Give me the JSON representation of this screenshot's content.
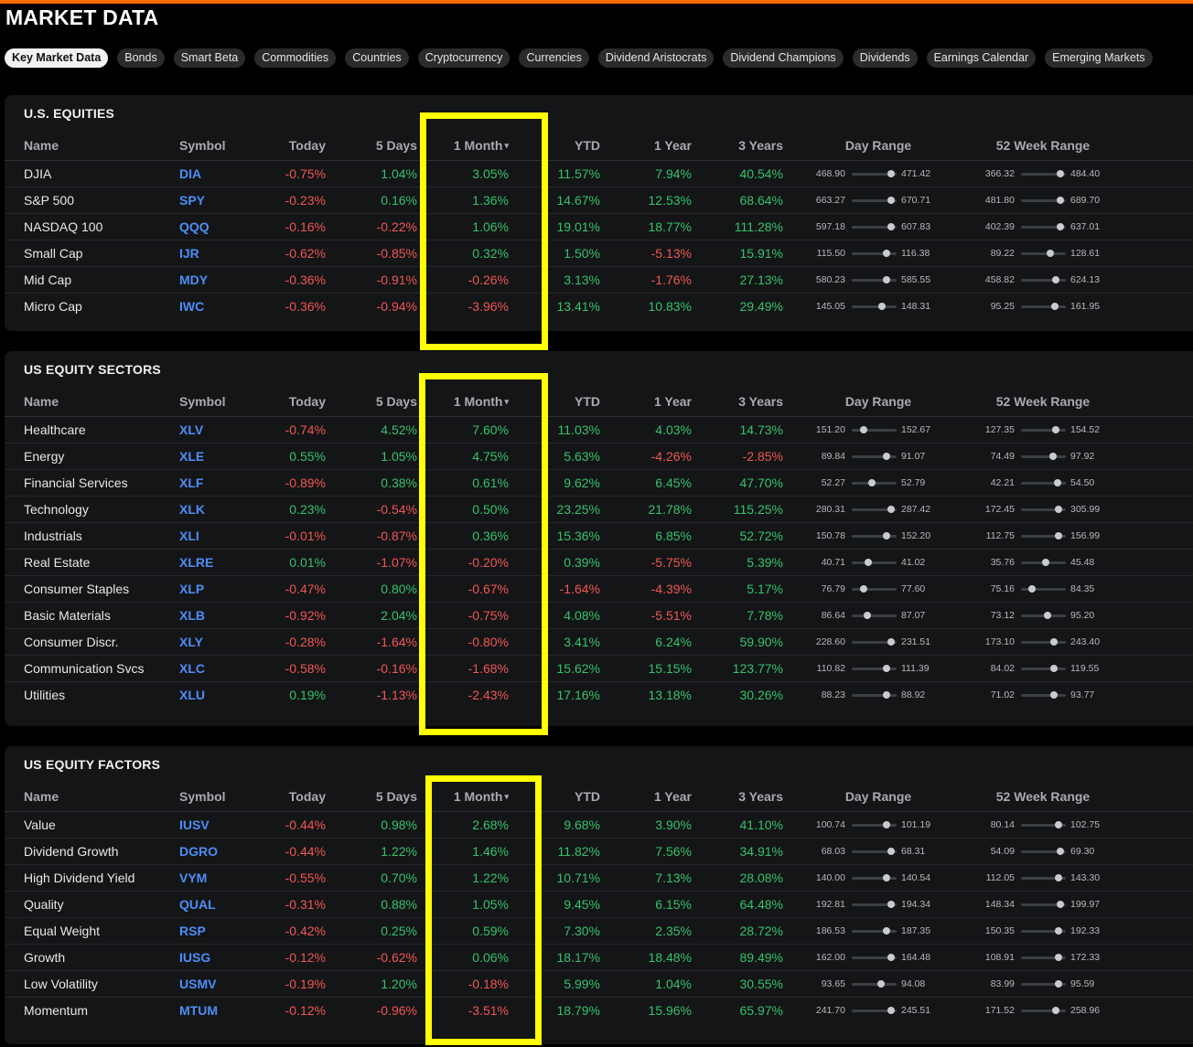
{
  "page": {
    "title": "MARKET DATA",
    "accent_color": "#ff6a00",
    "highlight_color": "#ffff00"
  },
  "tabs": [
    "Key Market Data",
    "Bonds",
    "Smart Beta",
    "Commodities",
    "Countries",
    "Cryptocurrency",
    "Currencies",
    "Dividend Aristocrats",
    "Dividend Champions",
    "Dividends",
    "Earnings Calendar",
    "Emerging Markets"
  ],
  "active_tab": "Key Market Data",
  "columns": {
    "name": "Name",
    "symbol": "Symbol",
    "today": "Today",
    "five_days": "5 Days",
    "one_month": "1 Month",
    "sort_indicator": "▾",
    "ytd": "YTD",
    "one_year": "1 Year",
    "three_years": "3 Years",
    "day_range": "Day Range",
    "week52_range": "52 Week Range"
  },
  "sections": [
    {
      "title": "U.S. EQUITIES",
      "rows": [
        {
          "name": "DJIA",
          "symbol": "DIA",
          "today": "-0.75%",
          "five_days": "1.04%",
          "one_month": "3.05%",
          "ytd": "11.57%",
          "one_year": "7.94%",
          "three_years": "40.54%",
          "day_low": "468.90",
          "day_high": "471.42",
          "day_pos": 0.88,
          "wk_low": "366.32",
          "wk_high": "484.40",
          "wk_pos": 0.88
        },
        {
          "name": "S&P 500",
          "symbol": "SPY",
          "today": "-0.23%",
          "five_days": "0.16%",
          "one_month": "1.36%",
          "ytd": "14.67%",
          "one_year": "12.53%",
          "three_years": "68.64%",
          "day_low": "663.27",
          "day_high": "670.71",
          "day_pos": 0.88,
          "wk_low": "481.80",
          "wk_high": "689.70",
          "wk_pos": 0.88
        },
        {
          "name": "NASDAQ 100",
          "symbol": "QQQ",
          "today": "-0.16%",
          "five_days": "-0.22%",
          "one_month": "1.06%",
          "ytd": "19.01%",
          "one_year": "18.77%",
          "three_years": "111.28%",
          "day_low": "597.18",
          "day_high": "607.83",
          "day_pos": 0.88,
          "wk_low": "402.39",
          "wk_high": "637.01",
          "wk_pos": 0.88
        },
        {
          "name": "Small Cap",
          "symbol": "IJR",
          "today": "-0.62%",
          "five_days": "-0.85%",
          "one_month": "0.32%",
          "ytd": "1.50%",
          "one_year": "-5.13%",
          "three_years": "15.91%",
          "day_low": "115.50",
          "day_high": "116.38",
          "day_pos": 0.77,
          "wk_low": "89.22",
          "wk_high": "128.61",
          "wk_pos": 0.66
        },
        {
          "name": "Mid Cap",
          "symbol": "MDY",
          "today": "-0.36%",
          "five_days": "-0.91%",
          "one_month": "-0.26%",
          "ytd": "3.13%",
          "one_year": "-1.76%",
          "three_years": "27.13%",
          "day_low": "580.23",
          "day_high": "585.55",
          "day_pos": 0.78,
          "wk_low": "458.82",
          "wk_high": "624.13",
          "wk_pos": 0.77
        },
        {
          "name": "Micro Cap",
          "symbol": "IWC",
          "today": "-0.36%",
          "five_days": "-0.94%",
          "one_month": "-3.96%",
          "ytd": "13.41%",
          "one_year": "10.83%",
          "three_years": "29.49%",
          "day_low": "145.05",
          "day_high": "148.31",
          "day_pos": 0.67,
          "wk_low": "95.25",
          "wk_high": "161.95",
          "wk_pos": 0.76
        }
      ]
    },
    {
      "title": "US EQUITY SECTORS",
      "rows": [
        {
          "name": "Healthcare",
          "symbol": "XLV",
          "today": "-0.74%",
          "five_days": "4.52%",
          "one_month": "7.60%",
          "ytd": "11.03%",
          "one_year": "4.03%",
          "three_years": "14.73%",
          "day_low": "151.20",
          "day_high": "152.67",
          "day_pos": 0.27,
          "wk_low": "127.35",
          "wk_high": "154.52",
          "wk_pos": 0.77
        },
        {
          "name": "Energy",
          "symbol": "XLE",
          "today": "0.55%",
          "five_days": "1.05%",
          "one_month": "4.75%",
          "ytd": "5.63%",
          "one_year": "-4.26%",
          "three_years": "-2.85%",
          "day_low": "89.84",
          "day_high": "91.07",
          "day_pos": 0.77,
          "wk_low": "74.49",
          "wk_high": "97.92",
          "wk_pos": 0.72
        },
        {
          "name": "Financial Services",
          "symbol": "XLF",
          "today": "-0.89%",
          "five_days": "0.38%",
          "one_month": "0.61%",
          "ytd": "9.62%",
          "one_year": "6.45%",
          "three_years": "47.70%",
          "day_low": "52.27",
          "day_high": "52.79",
          "day_pos": 0.45,
          "wk_low": "42.21",
          "wk_high": "54.50",
          "wk_pos": 0.81
        },
        {
          "name": "Technology",
          "symbol": "XLK",
          "today": "0.23%",
          "five_days": "-0.54%",
          "one_month": "0.50%",
          "ytd": "23.25%",
          "one_year": "21.78%",
          "three_years": "115.25%",
          "day_low": "280.31",
          "day_high": "287.42",
          "day_pos": 0.88,
          "wk_low": "172.45",
          "wk_high": "305.99",
          "wk_pos": 0.83
        },
        {
          "name": "Industrials",
          "symbol": "XLI",
          "today": "-0.01%",
          "five_days": "-0.87%",
          "one_month": "0.36%",
          "ytd": "15.36%",
          "one_year": "6.85%",
          "three_years": "52.72%",
          "day_low": "150.78",
          "day_high": "152.20",
          "day_pos": 0.77,
          "wk_low": "112.75",
          "wk_high": "156.99",
          "wk_pos": 0.83
        },
        {
          "name": "Real Estate",
          "symbol": "XLRE",
          "today": "0.01%",
          "five_days": "-1.07%",
          "one_month": "-0.20%",
          "ytd": "0.39%",
          "one_year": "-5.75%",
          "three_years": "5.39%",
          "day_low": "40.71",
          "day_high": "41.02",
          "day_pos": 0.37,
          "wk_low": "35.76",
          "wk_high": "45.48",
          "wk_pos": 0.55
        },
        {
          "name": "Consumer Staples",
          "symbol": "XLP",
          "today": "-0.47%",
          "five_days": "0.80%",
          "one_month": "-0.67%",
          "ytd": "-1.64%",
          "one_year": "-4.39%",
          "three_years": "5.17%",
          "day_low": "76.79",
          "day_high": "77.60",
          "day_pos": 0.27,
          "wk_low": "75.16",
          "wk_high": "84.35",
          "wk_pos": 0.24
        },
        {
          "name": "Basic Materials",
          "symbol": "XLB",
          "today": "-0.92%",
          "five_days": "2.04%",
          "one_month": "-0.75%",
          "ytd": "4.08%",
          "one_year": "-5.51%",
          "three_years": "7.78%",
          "day_low": "86.64",
          "day_high": "87.07",
          "day_pos": 0.35,
          "wk_low": "73.12",
          "wk_high": "95.20",
          "wk_pos": 0.6
        },
        {
          "name": "Consumer Discr.",
          "symbol": "XLY",
          "today": "-0.28%",
          "five_days": "-1.64%",
          "one_month": "-0.80%",
          "ytd": "3.41%",
          "one_year": "6.24%",
          "three_years": "59.90%",
          "day_low": "228.60",
          "day_high": "231.51",
          "day_pos": 0.88,
          "wk_low": "173.10",
          "wk_high": "243.40",
          "wk_pos": 0.74
        },
        {
          "name": "Communication Svcs",
          "symbol": "XLC",
          "today": "-0.58%",
          "five_days": "-0.16%",
          "one_month": "-1.68%",
          "ytd": "15.62%",
          "one_year": "15.15%",
          "three_years": "123.77%",
          "day_low": "110.82",
          "day_high": "111.39",
          "day_pos": 0.77,
          "wk_low": "84.02",
          "wk_high": "119.55",
          "wk_pos": 0.74
        },
        {
          "name": "Utilities",
          "symbol": "XLU",
          "today": "0.19%",
          "five_days": "-1.13%",
          "one_month": "-2.43%",
          "ytd": "17.16%",
          "one_year": "13.18%",
          "three_years": "30.26%",
          "day_low": "88.23",
          "day_high": "88.92",
          "day_pos": 0.77,
          "wk_low": "71.02",
          "wk_high": "93.77",
          "wk_pos": 0.74
        }
      ]
    },
    {
      "title": "US EQUITY FACTORS",
      "rows": [
        {
          "name": "Value",
          "symbol": "IUSV",
          "today": "-0.44%",
          "five_days": "0.98%",
          "one_month": "2.68%",
          "ytd": "9.68%",
          "one_year": "3.90%",
          "three_years": "41.10%",
          "day_low": "100.74",
          "day_high": "101.19",
          "day_pos": 0.77,
          "wk_low": "80.14",
          "wk_high": "102.75",
          "wk_pos": 0.83
        },
        {
          "name": "Dividend Growth",
          "symbol": "DGRO",
          "today": "-0.44%",
          "five_days": "1.22%",
          "one_month": "1.46%",
          "ytd": "11.82%",
          "one_year": "7.56%",
          "three_years": "34.91%",
          "day_low": "68.03",
          "day_high": "68.31",
          "day_pos": 0.88,
          "wk_low": "54.09",
          "wk_high": "69.30",
          "wk_pos": 0.88
        },
        {
          "name": "High Dividend Yield",
          "symbol": "VYM",
          "today": "-0.55%",
          "five_days": "0.70%",
          "one_month": "1.22%",
          "ytd": "10.71%",
          "one_year": "7.13%",
          "three_years": "28.08%",
          "day_low": "140.00",
          "day_high": "140.54",
          "day_pos": 0.77,
          "wk_low": "112.05",
          "wk_high": "143.30",
          "wk_pos": 0.83
        },
        {
          "name": "Quality",
          "symbol": "QUAL",
          "today": "-0.31%",
          "five_days": "0.88%",
          "one_month": "1.05%",
          "ytd": "9.45%",
          "one_year": "6.15%",
          "three_years": "64.48%",
          "day_low": "192.81",
          "day_high": "194.34",
          "day_pos": 0.88,
          "wk_low": "148.34",
          "wk_high": "199.97",
          "wk_pos": 0.88
        },
        {
          "name": "Equal Weight",
          "symbol": "RSP",
          "today": "-0.42%",
          "five_days": "0.25%",
          "one_month": "0.59%",
          "ytd": "7.30%",
          "one_year": "2.35%",
          "three_years": "28.72%",
          "day_low": "186.53",
          "day_high": "187.35",
          "day_pos": 0.77,
          "wk_low": "150.35",
          "wk_high": "192.33",
          "wk_pos": 0.83
        },
        {
          "name": "Growth",
          "symbol": "IUSG",
          "today": "-0.12%",
          "five_days": "-0.62%",
          "one_month": "0.06%",
          "ytd": "18.17%",
          "one_year": "18.48%",
          "three_years": "89.49%",
          "day_low": "162.00",
          "day_high": "164.48",
          "day_pos": 0.88,
          "wk_low": "108.91",
          "wk_high": "172.33",
          "wk_pos": 0.83
        },
        {
          "name": "Low Volatility",
          "symbol": "USMV",
          "today": "-0.19%",
          "five_days": "1.20%",
          "one_month": "-0.18%",
          "ytd": "5.99%",
          "one_year": "1.04%",
          "three_years": "30.55%",
          "day_low": "93.65",
          "day_high": "94.08",
          "day_pos": 0.65,
          "wk_low": "83.99",
          "wk_high": "95.59",
          "wk_pos": 0.83
        },
        {
          "name": "Momentum",
          "symbol": "MTUM",
          "today": "-0.12%",
          "five_days": "-0.96%",
          "one_month": "-3.51%",
          "ytd": "18.79%",
          "one_year": "15.96%",
          "three_years": "65.97%",
          "day_low": "241.70",
          "day_high": "245.51",
          "day_pos": 0.88,
          "wk_low": "171.52",
          "wk_high": "258.96",
          "wk_pos": 0.77
        }
      ]
    }
  ]
}
